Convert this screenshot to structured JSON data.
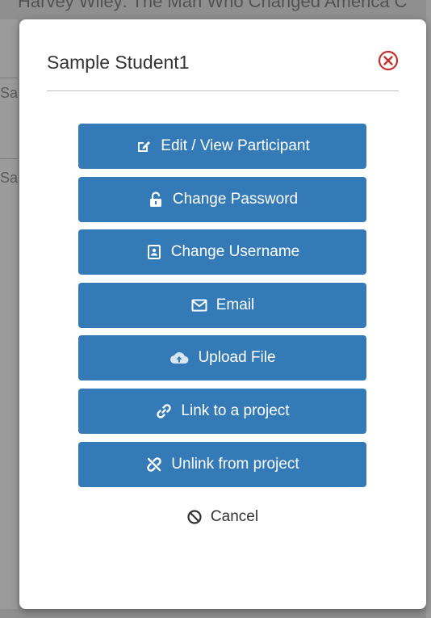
{
  "background": {
    "title_fragment": "Harvey Wiley: The Man Who Changed America C",
    "row_fragments": [
      "Sa",
      "Sa"
    ]
  },
  "modal": {
    "title": "Sample Student1",
    "close_icon": "close-circle-icon",
    "actions": [
      {
        "label": "Edit / View Participant",
        "icon": "edit-icon"
      },
      {
        "label": "Change Password",
        "icon": "unlock-icon"
      },
      {
        "label": "Change Username",
        "icon": "id-card-icon"
      },
      {
        "label": "Email",
        "icon": "envelope-icon"
      },
      {
        "label": "Upload File",
        "icon": "cloud-upload-icon"
      },
      {
        "label": "Link to a project",
        "icon": "link-icon"
      },
      {
        "label": "Unlink from project",
        "icon": "unlink-icon"
      }
    ],
    "cancel": {
      "label": "Cancel",
      "icon": "ban-icon"
    }
  },
  "colors": {
    "button": "#337ab7",
    "close": "#c9302c",
    "backdrop": "#8f8f8f"
  }
}
